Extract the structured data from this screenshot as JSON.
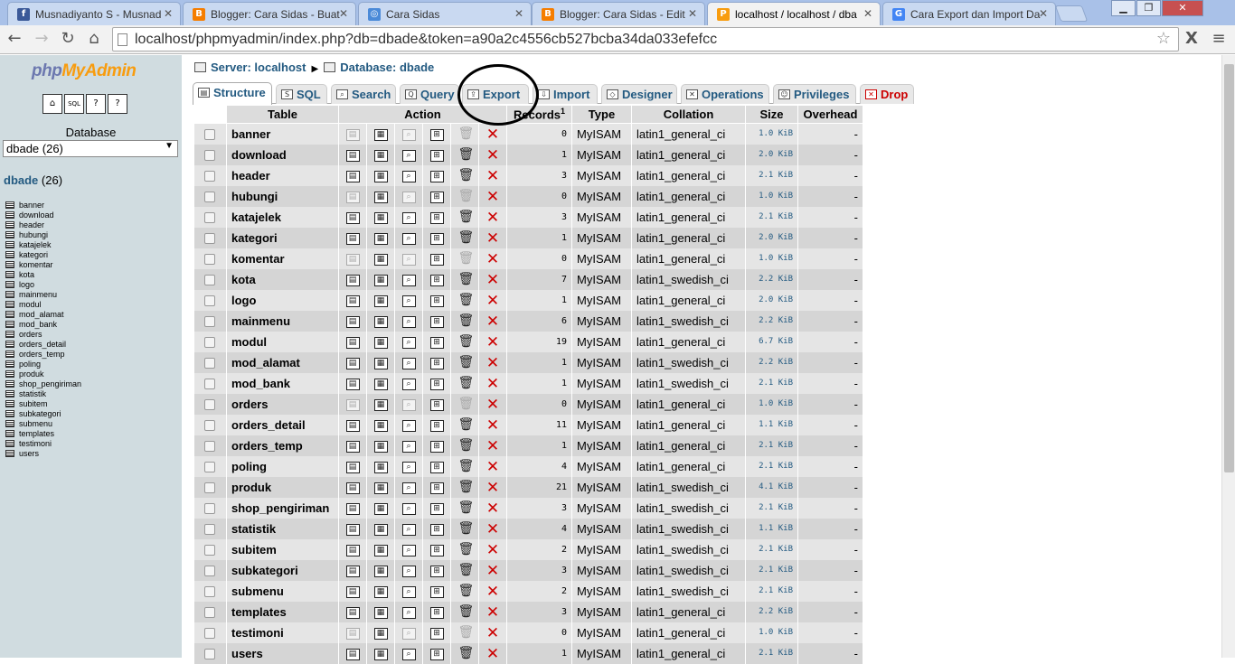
{
  "browser": {
    "tabs": [
      {
        "title": "Musnadiyanto S - Musnad",
        "icon": "facebook-icon",
        "color": "#3b5998",
        "letter": "f"
      },
      {
        "title": "Blogger: Cara Sidas - Buat",
        "icon": "blogger-icon",
        "color": "#f57d00",
        "letter": "B"
      },
      {
        "title": "Cara Sidas",
        "icon": "globe-icon",
        "color": "#4a8ad8",
        "letter": "◎"
      },
      {
        "title": "Blogger: Cara Sidas - Edit",
        "icon": "blogger-icon",
        "color": "#f57d00",
        "letter": "B"
      },
      {
        "title": "localhost / localhost / dba",
        "icon": "phpmyadmin-icon",
        "color": "#f89c0e",
        "letter": "P"
      },
      {
        "title": "Cara Export dan Import Da",
        "icon": "google-icon",
        "color": "#4285f4",
        "letter": "G"
      }
    ],
    "active_tab": 4,
    "url": "localhost/phpmyadmin/index.php?db=dbade&token=a90a2c4556cb527bcba34da033efefcc"
  },
  "sidebar": {
    "logo_php": "php",
    "logo_my": "MyAdmin",
    "database_label": "Database",
    "selected_db": "dbade (26)",
    "db_name": "dbade",
    "db_count": "(26)",
    "tables": [
      "banner",
      "download",
      "header",
      "hubungi",
      "katajelek",
      "kategori",
      "komentar",
      "kota",
      "logo",
      "mainmenu",
      "modul",
      "mod_alamat",
      "mod_bank",
      "orders",
      "orders_detail",
      "orders_temp",
      "poling",
      "produk",
      "shop_pengiriman",
      "statistik",
      "subitem",
      "subkategori",
      "submenu",
      "templates",
      "testimoni",
      "users"
    ]
  },
  "breadcrumb": {
    "server": "Server: localhost",
    "database": "Database: dbade"
  },
  "tabs": {
    "structure": "Structure",
    "sql": "SQL",
    "search": "Search",
    "query": "Query",
    "export": "Export",
    "import": "Import",
    "designer": "Designer",
    "operations": "Operations",
    "privileges": "Privileges",
    "drop": "Drop"
  },
  "table": {
    "headers": {
      "table": "Table",
      "action": "Action",
      "records": "Records",
      "records_sup": "1",
      "type": "Type",
      "collation": "Collation",
      "size": "Size",
      "overhead": "Overhead"
    },
    "rows": [
      {
        "name": "banner",
        "records": "0",
        "type": "MyISAM",
        "collation": "latin1_general_ci",
        "size": "1.0 KiB",
        "overhead": "-",
        "empty": true
      },
      {
        "name": "download",
        "records": "1",
        "type": "MyISAM",
        "collation": "latin1_general_ci",
        "size": "2.0 KiB",
        "overhead": "-",
        "empty": false
      },
      {
        "name": "header",
        "records": "3",
        "type": "MyISAM",
        "collation": "latin1_general_ci",
        "size": "2.1 KiB",
        "overhead": "-",
        "empty": false
      },
      {
        "name": "hubungi",
        "records": "0",
        "type": "MyISAM",
        "collation": "latin1_general_ci",
        "size": "1.0 KiB",
        "overhead": "-",
        "empty": true
      },
      {
        "name": "katajelek",
        "records": "3",
        "type": "MyISAM",
        "collation": "latin1_general_ci",
        "size": "2.1 KiB",
        "overhead": "-",
        "empty": false
      },
      {
        "name": "kategori",
        "records": "1",
        "type": "MyISAM",
        "collation": "latin1_general_ci",
        "size": "2.0 KiB",
        "overhead": "-",
        "empty": false
      },
      {
        "name": "komentar",
        "records": "0",
        "type": "MyISAM",
        "collation": "latin1_general_ci",
        "size": "1.0 KiB",
        "overhead": "-",
        "empty": true
      },
      {
        "name": "kota",
        "records": "7",
        "type": "MyISAM",
        "collation": "latin1_swedish_ci",
        "size": "2.2 KiB",
        "overhead": "-",
        "empty": false
      },
      {
        "name": "logo",
        "records": "1",
        "type": "MyISAM",
        "collation": "latin1_general_ci",
        "size": "2.0 KiB",
        "overhead": "-",
        "empty": false
      },
      {
        "name": "mainmenu",
        "records": "6",
        "type": "MyISAM",
        "collation": "latin1_swedish_ci",
        "size": "2.2 KiB",
        "overhead": "-",
        "empty": false
      },
      {
        "name": "modul",
        "records": "19",
        "type": "MyISAM",
        "collation": "latin1_general_ci",
        "size": "6.7 KiB",
        "overhead": "-",
        "empty": false
      },
      {
        "name": "mod_alamat",
        "records": "1",
        "type": "MyISAM",
        "collation": "latin1_swedish_ci",
        "size": "2.2 KiB",
        "overhead": "-",
        "empty": false
      },
      {
        "name": "mod_bank",
        "records": "1",
        "type": "MyISAM",
        "collation": "latin1_swedish_ci",
        "size": "2.1 KiB",
        "overhead": "-",
        "empty": false
      },
      {
        "name": "orders",
        "records": "0",
        "type": "MyISAM",
        "collation": "latin1_general_ci",
        "size": "1.0 KiB",
        "overhead": "-",
        "empty": true
      },
      {
        "name": "orders_detail",
        "records": "11",
        "type": "MyISAM",
        "collation": "latin1_general_ci",
        "size": "1.1 KiB",
        "overhead": "-",
        "empty": false
      },
      {
        "name": "orders_temp",
        "records": "1",
        "type": "MyISAM",
        "collation": "latin1_general_ci",
        "size": "2.1 KiB",
        "overhead": "-",
        "empty": false
      },
      {
        "name": "poling",
        "records": "4",
        "type": "MyISAM",
        "collation": "latin1_general_ci",
        "size": "2.1 KiB",
        "overhead": "-",
        "empty": false
      },
      {
        "name": "produk",
        "records": "21",
        "type": "MyISAM",
        "collation": "latin1_swedish_ci",
        "size": "4.1 KiB",
        "overhead": "-",
        "empty": false
      },
      {
        "name": "shop_pengiriman",
        "records": "3",
        "type": "MyISAM",
        "collation": "latin1_swedish_ci",
        "size": "2.1 KiB",
        "overhead": "-",
        "empty": false
      },
      {
        "name": "statistik",
        "records": "4",
        "type": "MyISAM",
        "collation": "latin1_swedish_ci",
        "size": "1.1 KiB",
        "overhead": "-",
        "empty": false
      },
      {
        "name": "subitem",
        "records": "2",
        "type": "MyISAM",
        "collation": "latin1_swedish_ci",
        "size": "2.1 KiB",
        "overhead": "-",
        "empty": false
      },
      {
        "name": "subkategori",
        "records": "3",
        "type": "MyISAM",
        "collation": "latin1_swedish_ci",
        "size": "2.1 KiB",
        "overhead": "-",
        "empty": false
      },
      {
        "name": "submenu",
        "records": "2",
        "type": "MyISAM",
        "collation": "latin1_swedish_ci",
        "size": "2.1 KiB",
        "overhead": "-",
        "empty": false
      },
      {
        "name": "templates",
        "records": "3",
        "type": "MyISAM",
        "collation": "latin1_general_ci",
        "size": "2.2 KiB",
        "overhead": "-",
        "empty": false
      },
      {
        "name": "testimoni",
        "records": "0",
        "type": "MyISAM",
        "collation": "latin1_general_ci",
        "size": "1.0 KiB",
        "overhead": "-",
        "empty": true
      },
      {
        "name": "users",
        "records": "1",
        "type": "MyISAM",
        "collation": "latin1_general_ci",
        "size": "2.1 KiB",
        "overhead": "-",
        "empty": false
      }
    ]
  }
}
